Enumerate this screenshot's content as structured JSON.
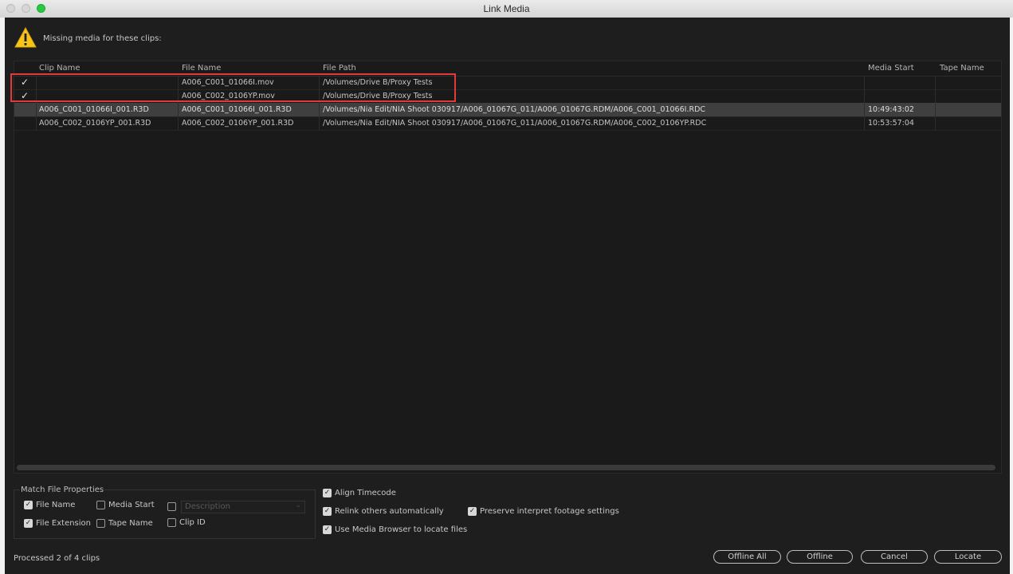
{
  "window": {
    "title": "Link Media"
  },
  "message": "Missing media for these clips:",
  "table": {
    "columns": [
      "Clip Name",
      "File Name",
      "File Path",
      "Media Start",
      "Tape Name"
    ],
    "rows": [
      {
        "checked": true,
        "selected": false,
        "clip_name": "",
        "file_name": "A006_C001_01066I.mov",
        "file_path": "/Volumes/Drive B/Proxy Tests",
        "media_start": "",
        "tape_name": ""
      },
      {
        "checked": true,
        "selected": false,
        "clip_name": "",
        "file_name": "A006_C002_0106YP.mov",
        "file_path": "/Volumes/Drive B/Proxy Tests",
        "media_start": "",
        "tape_name": ""
      },
      {
        "checked": false,
        "selected": true,
        "clip_name": "A006_C001_01066I_001.R3D",
        "file_name": "A006_C001_01066I_001.R3D",
        "file_path": "/Volumes/Nia Edit/NIA Shoot 030917/A006_01067G_011/A006_01067G.RDM/A006_C001_01066I.RDC",
        "media_start": "10:49:43:02",
        "tape_name": ""
      },
      {
        "checked": false,
        "selected": false,
        "clip_name": "A006_C002_0106YP_001.R3D",
        "file_name": "A006_C002_0106YP_001.R3D",
        "file_path": "/Volumes/Nia Edit/NIA Shoot 030917/A006_01067G_011/A006_01067G.RDM/A006_C002_0106YP.RDC",
        "media_start": "10:53:57:04",
        "tape_name": ""
      }
    ]
  },
  "match_properties": {
    "title": "Match File Properties",
    "file_name": {
      "label": "File Name",
      "checked": true
    },
    "media_start": {
      "label": "Media Start",
      "checked": false
    },
    "description": {
      "label": "Description",
      "checked": false
    },
    "file_extension": {
      "label": "File Extension",
      "checked": true
    },
    "tape_name": {
      "label": "Tape Name",
      "checked": false
    },
    "clip_id": {
      "label": "Clip ID",
      "checked": false
    }
  },
  "options": {
    "align_timecode": {
      "label": "Align Timecode",
      "checked": true
    },
    "relink_auto": {
      "label": "Relink others automatically",
      "checked": true
    },
    "preserve_interpret": {
      "label": "Preserve interpret footage settings",
      "checked": true
    },
    "use_media_browser": {
      "label": "Use Media Browser to locate files",
      "checked": true
    }
  },
  "status": "Processed 2 of 4 clips",
  "buttons": {
    "offline_all": "Offline All",
    "offline": "Offline",
    "cancel": "Cancel",
    "locate": "Locate"
  }
}
